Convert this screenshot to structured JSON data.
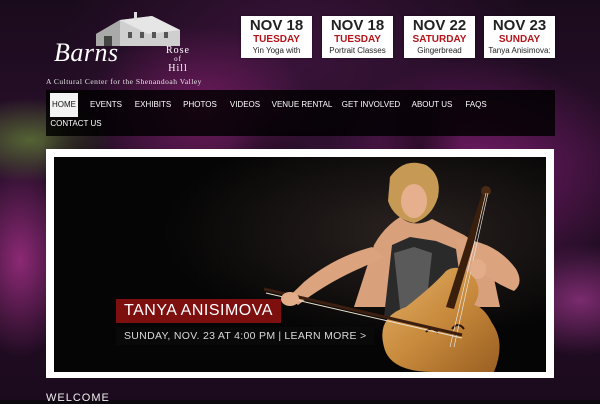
{
  "logo": {
    "wordmark": "Barns",
    "rose_line1": "Rose",
    "rose_line2": "of",
    "rose_line3": "Hill",
    "tagline": "A Cultural Center for the Shenandoah Valley"
  },
  "events": [
    {
      "date": "NOV 18",
      "day": "TUESDAY",
      "title": "Yin Yoga with"
    },
    {
      "date": "NOV 18",
      "day": "TUESDAY",
      "title": "Portrait Classes"
    },
    {
      "date": "NOV 22",
      "day": "SATURDAY",
      "title": "Gingerbread"
    },
    {
      "date": "NOV 23",
      "day": "SUNDAY",
      "title": "Tanya Anisimova:"
    }
  ],
  "nav": [
    "HOME",
    "EVENTS",
    "EXHIBITS",
    "PHOTOS",
    "VIDEOS",
    "VENUE RENTAL",
    "GET INVOLVED",
    "ABOUT US",
    "FAQS",
    "CONTACT US"
  ],
  "slide": {
    "name": "TANYA ANISIMOVA",
    "when": "SUNDAY, NOV. 23 AT 4:00 PM",
    "separator": "|",
    "cta": "LEARN MORE >"
  },
  "welcome": "WELCOME",
  "colors": {
    "accent_red": "#b3151a",
    "caption_red": "#7e0f0f",
    "nav_active_bg": "#f3f3f3"
  }
}
